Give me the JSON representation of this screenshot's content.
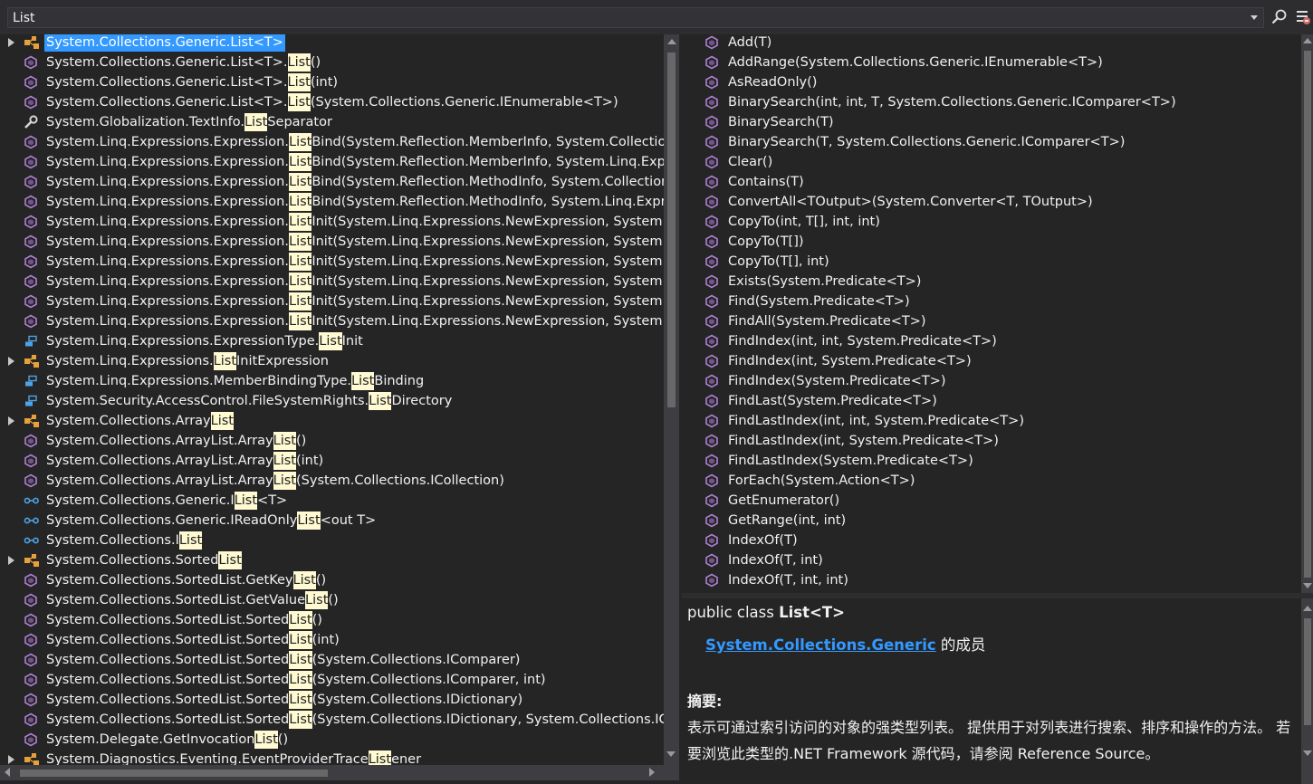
{
  "search": {
    "value": "List"
  },
  "icons": {
    "search": "search-icon",
    "settings": "settings-icon",
    "class": "class-icon",
    "method": "method-icon",
    "property": "property-icon",
    "enum_member": "enum-member-icon",
    "interface": "interface-icon"
  },
  "colors": {
    "selection": "#3399ff",
    "highlight": "#fffad2",
    "method_icon": "#b180d7",
    "class_icon": "#e8a13a",
    "interface_icon": "#4fa3e6",
    "link": "#3399ff"
  },
  "results": [
    {
      "pre": "System.Collections.Generic.List<T>",
      "hl": "",
      "post": "",
      "icon": "class",
      "expandable": true,
      "selected": true
    },
    {
      "pre": "System.Collections.Generic.List<T>.",
      "hl": "List",
      "post": "()",
      "icon": "method",
      "expandable": false
    },
    {
      "pre": "System.Collections.Generic.List<T>.",
      "hl": "List",
      "post": "(int)",
      "icon": "method",
      "expandable": false
    },
    {
      "pre": "System.Collections.Generic.List<T>.",
      "hl": "List",
      "post": "(System.Collections.Generic.IEnumerable<T>)",
      "icon": "method",
      "expandable": false
    },
    {
      "pre": "System.Globalization.TextInfo.",
      "hl": "List",
      "post": "Separator",
      "icon": "property",
      "expandable": false
    },
    {
      "pre": "System.Linq.Expressions.Expression.",
      "hl": "List",
      "post": "Bind(System.Reflection.MemberInfo, System.Collectio",
      "icon": "method",
      "expandable": false
    },
    {
      "pre": "System.Linq.Expressions.Expression.",
      "hl": "List",
      "post": "Bind(System.Reflection.MemberInfo, System.Linq.Expr",
      "icon": "method",
      "expandable": false
    },
    {
      "pre": "System.Linq.Expressions.Expression.",
      "hl": "List",
      "post": "Bind(System.Reflection.MethodInfo, System.Collection",
      "icon": "method",
      "expandable": false
    },
    {
      "pre": "System.Linq.Expressions.Expression.",
      "hl": "List",
      "post": "Bind(System.Reflection.MethodInfo, System.Linq.Expr",
      "icon": "method",
      "expandable": false
    },
    {
      "pre": "System.Linq.Expressions.Expression.",
      "hl": "List",
      "post": "Init(System.Linq.Expressions.NewExpression, System.C",
      "icon": "method",
      "expandable": false
    },
    {
      "pre": "System.Linq.Expressions.Expression.",
      "hl": "List",
      "post": "Init(System.Linq.Expressions.NewExpression, System.C",
      "icon": "method",
      "expandable": false
    },
    {
      "pre": "System.Linq.Expressions.Expression.",
      "hl": "List",
      "post": "Init(System.Linq.Expressions.NewExpression, System.L",
      "icon": "method",
      "expandable": false
    },
    {
      "pre": "System.Linq.Expressions.Expression.",
      "hl": "List",
      "post": "Init(System.Linq.Expressions.NewExpression, System.L",
      "icon": "method",
      "expandable": false
    },
    {
      "pre": "System.Linq.Expressions.Expression.",
      "hl": "List",
      "post": "Init(System.Linq.Expressions.NewExpression, System.R",
      "icon": "method",
      "expandable": false
    },
    {
      "pre": "System.Linq.Expressions.Expression.",
      "hl": "List",
      "post": "Init(System.Linq.Expressions.NewExpression, System.R",
      "icon": "method",
      "expandable": false
    },
    {
      "pre": "System.Linq.Expressions.ExpressionType.",
      "hl": "List",
      "post": "Init",
      "icon": "enum_member",
      "expandable": false
    },
    {
      "pre": "System.Linq.Expressions.",
      "hl": "List",
      "post": "InitExpression",
      "icon": "class",
      "expandable": true
    },
    {
      "pre": "System.Linq.Expressions.MemberBindingType.",
      "hl": "List",
      "post": "Binding",
      "icon": "enum_member",
      "expandable": false
    },
    {
      "pre": "System.Security.AccessControl.FileSystemRights.",
      "hl": "List",
      "post": "Directory",
      "icon": "enum_member",
      "expandable": false
    },
    {
      "pre": "System.Collections.Array",
      "hl": "List",
      "post": "",
      "icon": "class",
      "expandable": true
    },
    {
      "pre": "System.Collections.ArrayList.Array",
      "hl": "List",
      "post": "()",
      "icon": "method",
      "expandable": false
    },
    {
      "pre": "System.Collections.ArrayList.Array",
      "hl": "List",
      "post": "(int)",
      "icon": "method",
      "expandable": false
    },
    {
      "pre": "System.Collections.ArrayList.Array",
      "hl": "List",
      "post": "(System.Collections.ICollection)",
      "icon": "method",
      "expandable": false
    },
    {
      "pre": "System.Collections.Generic.I",
      "hl": "List",
      "post": "<T>",
      "icon": "interface",
      "expandable": false
    },
    {
      "pre": "System.Collections.Generic.IReadOnly",
      "hl": "List",
      "post": "<out T>",
      "icon": "interface",
      "expandable": false
    },
    {
      "pre": "System.Collections.I",
      "hl": "List",
      "post": "",
      "icon": "interface",
      "expandable": false
    },
    {
      "pre": "System.Collections.Sorted",
      "hl": "List",
      "post": "",
      "icon": "class",
      "expandable": true
    },
    {
      "pre": "System.Collections.SortedList.GetKey",
      "hl": "List",
      "post": "()",
      "icon": "method",
      "expandable": false
    },
    {
      "pre": "System.Collections.SortedList.GetValue",
      "hl": "List",
      "post": "()",
      "icon": "method",
      "expandable": false
    },
    {
      "pre": "System.Collections.SortedList.Sorted",
      "hl": "List",
      "post": "()",
      "icon": "method",
      "expandable": false
    },
    {
      "pre": "System.Collections.SortedList.Sorted",
      "hl": "List",
      "post": "(int)",
      "icon": "method",
      "expandable": false
    },
    {
      "pre": "System.Collections.SortedList.Sorted",
      "hl": "List",
      "post": "(System.Collections.IComparer)",
      "icon": "method",
      "expandable": false
    },
    {
      "pre": "System.Collections.SortedList.Sorted",
      "hl": "List",
      "post": "(System.Collections.IComparer, int)",
      "icon": "method",
      "expandable": false
    },
    {
      "pre": "System.Collections.SortedList.Sorted",
      "hl": "List",
      "post": "(System.Collections.IDictionary)",
      "icon": "method",
      "expandable": false
    },
    {
      "pre": "System.Collections.SortedList.Sorted",
      "hl": "List",
      "post": "(System.Collections.IDictionary, System.Collections.IC",
      "icon": "method",
      "expandable": false
    },
    {
      "pre": "System.Delegate.GetInvocation",
      "hl": "List",
      "post": "()",
      "icon": "method",
      "expandable": false
    },
    {
      "pre": "System.Diagnostics.Eventing.EventProviderTrace",
      "hl": "List",
      "post": "ener",
      "icon": "class",
      "expandable": true
    }
  ],
  "members": [
    "Add(T)",
    "AddRange(System.Collections.Generic.IEnumerable<T>)",
    "AsReadOnly()",
    "BinarySearch(int, int, T, System.Collections.Generic.IComparer<T>)",
    "BinarySearch(T)",
    "BinarySearch(T, System.Collections.Generic.IComparer<T>)",
    "Clear()",
    "Contains(T)",
    "ConvertAll<TOutput>(System.Converter<T, TOutput>)",
    "CopyTo(int, T[], int, int)",
    "CopyTo(T[])",
    "CopyTo(T[], int)",
    "Exists(System.Predicate<T>)",
    "Find(System.Predicate<T>)",
    "FindAll(System.Predicate<T>)",
    "FindIndex(int, int, System.Predicate<T>)",
    "FindIndex(int, System.Predicate<T>)",
    "FindIndex(System.Predicate<T>)",
    "FindLast(System.Predicate<T>)",
    "FindLastIndex(int, int, System.Predicate<T>)",
    "FindLastIndex(int, System.Predicate<T>)",
    "FindLastIndex(System.Predicate<T>)",
    "ForEach(System.Action<T>)",
    "GetEnumerator()",
    "GetRange(int, int)",
    "IndexOf(T)",
    "IndexOf(T, int)",
    "IndexOf(T, int, int)"
  ],
  "info": {
    "decl_prefix": "public class ",
    "decl_name": "List<T>",
    "namespace_link": "System.Collections.Generic",
    "namespace_suffix": " 的成员",
    "summary_label": "摘要:",
    "summary_text": "表示可通过索引访问的对象的强类型列表。 提供用于对列表进行搜索、排序和操作的方法。 若要浏览此类型的.NET Framework 源代码，请参阅 Reference Source。"
  }
}
